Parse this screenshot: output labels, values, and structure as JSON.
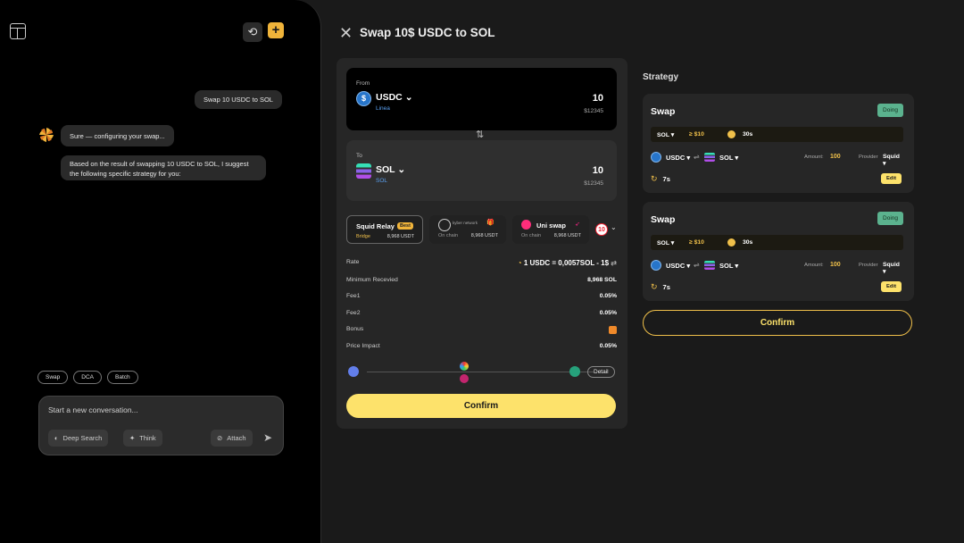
{
  "chat": {
    "user_message": "Swap 10 USDC to SOL",
    "ai_message_1": "Sure — configuring your swap...",
    "ai_message_2": "Based on the result of swapping 10 USDC to SOL, I suggest the following specific strategy for you:",
    "chips": [
      "Swap",
      "DCA",
      "Batch"
    ],
    "composer": {
      "placeholder": "Start a new conversation...",
      "deep_search": "Deep Search",
      "think": "Think",
      "attach": "Attach"
    }
  },
  "panel": {
    "title": "Swap 10$ USDC to SOL",
    "from": {
      "label": "From",
      "token": "USDC",
      "chain": "Linea",
      "amount": "10",
      "usd": "$12345"
    },
    "to": {
      "label": "To",
      "token": "SOL",
      "chain": "SOL",
      "amount": "10",
      "usd": "$12345"
    },
    "routes": [
      {
        "name": "Squid Relay",
        "badge": "Best",
        "type": "Bridge",
        "value": "8,968 USDT"
      },
      {
        "name": "kyber network",
        "type": "On chain",
        "value": "8,968 USDT"
      },
      {
        "name": "Uni swap",
        "type": "On chain",
        "value": "8,968 USDT"
      }
    ],
    "more_routes_count": "10",
    "details": {
      "rate_label": "Rate",
      "rate_value": "1 USDC = 0,0057SOL - 1$",
      "min_label": "Minimum Recevied",
      "min_value": "8,968 SOL",
      "fee1_label": "Fee1",
      "fee1_value": "0.05%",
      "fee2_label": "Fee2",
      "fee2_value": "0.05%",
      "bonus_label": "Bonus",
      "impact_label": "Price Impact",
      "impact_value": "0.05%"
    },
    "detail_button": "Detail",
    "confirm": "Confirm"
  },
  "strategy": {
    "heading": "Strategy",
    "cards": [
      {
        "title": "Swap",
        "status": "Doing",
        "bar_token": "SOL",
        "bar_amount": "$10",
        "bar_time": "30s",
        "from": "USDC",
        "to": "SOL",
        "amount_label": "Amount:",
        "amount": "100",
        "provider_label": "Provider",
        "provider": "Squid",
        "timer": "7s",
        "edit": "Edit"
      },
      {
        "title": "Swap",
        "status": "Doing",
        "bar_token": "SOL",
        "bar_amount": "$10",
        "bar_time": "30s",
        "from": "USDC",
        "to": "SOL",
        "amount_label": "Amount:",
        "amount": "100",
        "provider_label": "Provider",
        "provider": "Squid",
        "timer": "7s",
        "edit": "Edit"
      }
    ],
    "confirm": "Confirm"
  },
  "colors": {
    "accent": "#fde26b",
    "doing": "#5bb28e",
    "usdc": "#2775ca"
  }
}
